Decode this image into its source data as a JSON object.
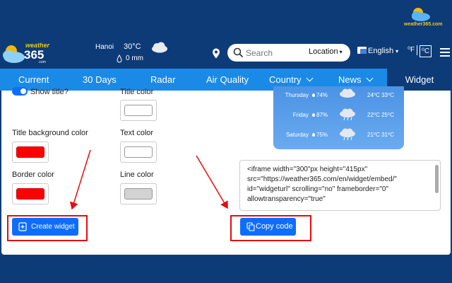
{
  "watermark": {
    "text": "weather365.com"
  },
  "header": {
    "brand_top": "weather",
    "brand_num": "365",
    "brand_sub": ".com",
    "location": "Hanoi",
    "temperature": "30°C",
    "rain": "0 mm",
    "icons": {
      "weather": "cloud-icon",
      "location": "pin-icon",
      "rain": "raindrop-icon"
    }
  },
  "search": {
    "placeholder": "Search",
    "mode_label": "Location"
  },
  "lang": {
    "label": "English",
    "flag": "uk-flag-icon"
  },
  "units": {
    "f": "⁰F",
    "c": "⁰C",
    "active": "c"
  },
  "nav": {
    "items": [
      {
        "label": "Current"
      },
      {
        "label": "30 Days"
      },
      {
        "label": "Radar"
      },
      {
        "label": "Air Quality"
      },
      {
        "label": "Country",
        "has_dropdown": true
      },
      {
        "label": "News",
        "has_dropdown": true
      }
    ],
    "active": {
      "label": "Widget"
    }
  },
  "form": {
    "show_title": {
      "label": "Show title?",
      "checked": true
    },
    "title_color": {
      "label": "Title color",
      "value": "#ffffff"
    },
    "title_bg_color": {
      "label": "Title background color",
      "value": "#ff0000"
    },
    "text_color": {
      "label": "Text color",
      "value": "#ffffff"
    },
    "border_color": {
      "label": "Border color",
      "value": "#ff0000"
    },
    "line_color": {
      "label": "Line color",
      "value": "#d3d3d3"
    }
  },
  "preview": {
    "rows": [
      {
        "day": "Thursday",
        "precip": "74%",
        "range": "24⁰C 33⁰C",
        "icon": "cloud-rain-icon"
      },
      {
        "day": "Friday",
        "precip": "87%",
        "range": "22⁰C 25⁰C",
        "icon": "cloud-rain-icon"
      },
      {
        "day": "Saturday",
        "precip": "75%",
        "range": "21⁰C 31⁰C",
        "icon": "cloud-rain-icon"
      }
    ]
  },
  "embed_code": "<iframe width=\"300\"px height=\"415px\"\nsrc=\"https://weather365.com/en/widget/embed/\"\nid=\"widgeturl\" scrolling=\"no\" frameborder=\"0\"\nallowtransparency=\"true\"",
  "buttons": {
    "create": "Create widget",
    "copy": "Copy code"
  },
  "colors": {
    "header_bg": "#0d3b78",
    "nav_bg": "#1a8ae6",
    "button": "#0d6efd",
    "highlight": "#e30d0d"
  }
}
